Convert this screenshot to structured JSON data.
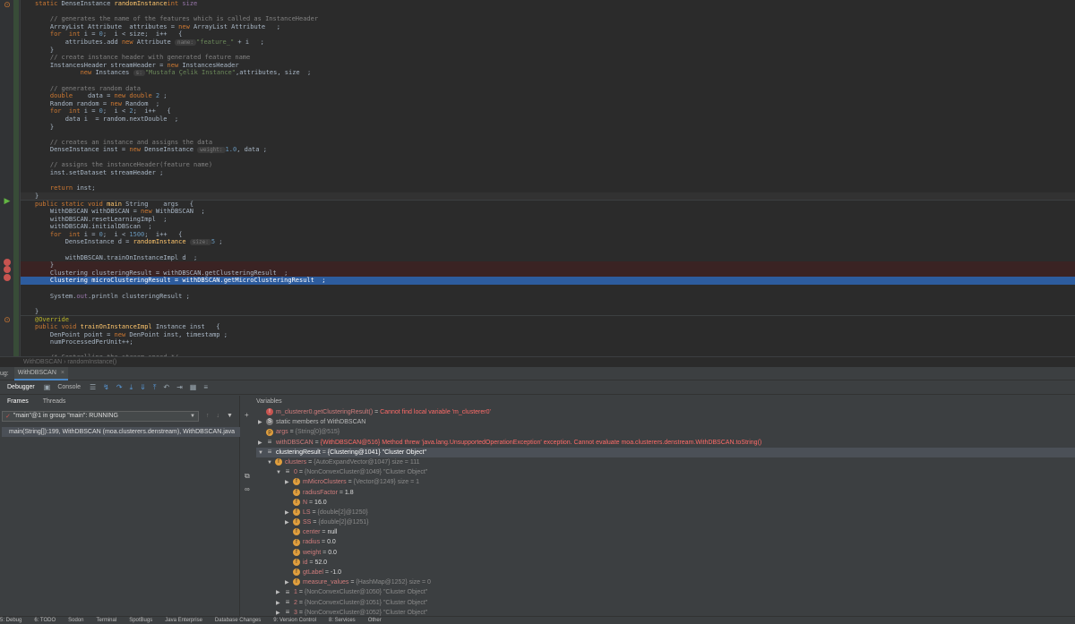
{
  "editor": {
    "lines": [
      {
        "kind": "code",
        "tokens": [
          [
            "kw",
            "static "
          ],
          [
            "",
            "DenseInstance "
          ],
          [
            "meth",
            "randomInstance"
          ],
          [
            "",
            ""
          ],
          [
            "kw",
            "int "
          ],
          [
            "fld",
            "size"
          ],
          [
            "",
            ""
          ]
        ]
      },
      {
        "kind": "blank",
        "tokens": []
      },
      {
        "kind": "code",
        "tokens": [
          [
            "cm",
            "    // generates the name of the features which is called as InstanceHeader"
          ]
        ]
      },
      {
        "kind": "code",
        "tokens": [
          [
            "",
            "    ArrayList Attribute  attributes = "
          ],
          [
            "kw",
            "new "
          ],
          [
            "",
            "ArrayList Attribute   ;"
          ]
        ]
      },
      {
        "kind": "code",
        "tokens": [
          [
            "kw",
            "    for  int "
          ],
          [
            "",
            "i = "
          ],
          [
            "num",
            "0"
          ],
          [
            "",
            ";  i < size;  i++   {"
          ]
        ]
      },
      {
        "kind": "code",
        "tokens": [
          [
            "",
            "        attributes.add "
          ],
          [
            "kw",
            "new "
          ],
          [
            "",
            "Attribute "
          ],
          [
            "hint",
            "name:"
          ],
          [
            "str",
            "\"feature_\""
          ],
          [
            "",
            " + i   ;"
          ]
        ]
      },
      {
        "kind": "code",
        "tokens": [
          [
            "",
            "    }"
          ]
        ]
      },
      {
        "kind": "code",
        "tokens": [
          [
            "cm",
            "    // create instance header with generated feature name"
          ]
        ]
      },
      {
        "kind": "code",
        "tokens": [
          [
            "",
            "    InstancesHeader streamHeader = "
          ],
          [
            "kw",
            "new "
          ],
          [
            "",
            "InstancesHeader"
          ]
        ]
      },
      {
        "kind": "code",
        "tokens": [
          [
            "",
            "            "
          ],
          [
            "kw",
            "new "
          ],
          [
            "",
            "Instances "
          ],
          [
            "hint",
            "s:"
          ],
          [
            "str",
            "\"Mustafa Çelik Instance\""
          ],
          [
            "",
            ",attributes, size  ;"
          ]
        ]
      },
      {
        "kind": "blank",
        "tokens": []
      },
      {
        "kind": "code",
        "tokens": [
          [
            "cm",
            "    // generates random data"
          ]
        ]
      },
      {
        "kind": "code",
        "tokens": [
          [
            "kw",
            "    double"
          ],
          [
            "",
            "    data = "
          ],
          [
            "kw",
            "new double "
          ],
          [
            "num",
            "2"
          ],
          [
            "",
            " ;"
          ]
        ]
      },
      {
        "kind": "code",
        "tokens": [
          [
            "",
            "    Random random = "
          ],
          [
            "kw",
            "new "
          ],
          [
            "",
            "Random  ;"
          ]
        ]
      },
      {
        "kind": "code",
        "tokens": [
          [
            "kw",
            "    for  int "
          ],
          [
            "",
            "i = "
          ],
          [
            "num",
            "0"
          ],
          [
            "",
            ";  i < "
          ],
          [
            "num",
            "2"
          ],
          [
            "",
            ";  i++   {"
          ]
        ]
      },
      {
        "kind": "code",
        "tokens": [
          [
            "",
            "        data i  = random.nextDouble  ;"
          ]
        ]
      },
      {
        "kind": "code",
        "tokens": [
          [
            "",
            "    }"
          ]
        ]
      },
      {
        "kind": "blank",
        "tokens": []
      },
      {
        "kind": "code",
        "tokens": [
          [
            "cm",
            "    // creates an instance and assigns the data"
          ]
        ]
      },
      {
        "kind": "code",
        "tokens": [
          [
            "",
            "    DenseInstance inst = "
          ],
          [
            "kw",
            "new "
          ],
          [
            "",
            "DenseInstance "
          ],
          [
            "hint",
            "weight:"
          ],
          [
            "num",
            "1.0"
          ],
          [
            "",
            ", data ;"
          ]
        ]
      },
      {
        "kind": "blank",
        "tokens": []
      },
      {
        "kind": "code",
        "tokens": [
          [
            "cm",
            "    // assigns the instanceHeader(feature name)"
          ]
        ]
      },
      {
        "kind": "code",
        "tokens": [
          [
            "",
            "    inst.setDataset streamHeader ;"
          ]
        ]
      },
      {
        "kind": "blank",
        "tokens": []
      },
      {
        "kind": "code",
        "tokens": [
          [
            "kw",
            "    return "
          ],
          [
            "",
            "inst;"
          ]
        ]
      },
      {
        "kind": "cur",
        "tokens": [
          [
            "",
            "}"
          ]
        ]
      },
      {
        "kind": "code",
        "tokens": [
          [
            "kw",
            "public static void "
          ],
          [
            "meth",
            "main "
          ],
          [
            "",
            "String    args   {"
          ]
        ]
      },
      {
        "kind": "code",
        "tokens": [
          [
            "",
            "    WithDBSCAN withDBSCAN = "
          ],
          [
            "kw",
            "new "
          ],
          [
            "",
            "WithDBSCAN  ;"
          ]
        ]
      },
      {
        "kind": "code",
        "tokens": [
          [
            "",
            "    withDBSCAN.resetLearningImpl  ;"
          ]
        ]
      },
      {
        "kind": "code",
        "tokens": [
          [
            "",
            "    withDBSCAN.initialDBScan  ;"
          ]
        ]
      },
      {
        "kind": "code",
        "tokens": [
          [
            "kw",
            "    for  int "
          ],
          [
            "",
            "i = "
          ],
          [
            "num",
            "0"
          ],
          [
            "",
            ";  i < "
          ],
          [
            "num",
            "1500"
          ],
          [
            "",
            ";  i++   {"
          ]
        ]
      },
      {
        "kind": "code",
        "tokens": [
          [
            "",
            "        DenseInstance d = "
          ],
          [
            "meth",
            "randomInstance "
          ],
          [
            "hint",
            "size:"
          ],
          [
            "num",
            "5"
          ],
          [
            "",
            " ;"
          ]
        ]
      },
      {
        "kind": "blank",
        "tokens": []
      },
      {
        "kind": "code",
        "tokens": [
          [
            "",
            "        withDBSCAN.trainOnInstanceImpl d  ;"
          ]
        ]
      },
      {
        "kind": "bp",
        "tokens": [
          [
            "",
            "    }"
          ]
        ]
      },
      {
        "kind": "bp",
        "tokens": [
          [
            "",
            "    Clustering clusteringResult = withDBSCAN.getClusteringResult  ;"
          ]
        ]
      },
      {
        "kind": "exec",
        "tokens": [
          [
            "",
            "    Clustering microClusteringResult = withDBSCAN.getMicroClusteringResult  ;"
          ]
        ]
      },
      {
        "kind": "blank",
        "tokens": []
      },
      {
        "kind": "code",
        "tokens": [
          [
            "",
            "    System."
          ],
          [
            "fld",
            "out"
          ],
          [
            "",
            ".println clusteringResult ;"
          ]
        ]
      },
      {
        "kind": "blank",
        "tokens": []
      },
      {
        "kind": "code",
        "tokens": [
          [
            "",
            "}"
          ]
        ]
      },
      {
        "kind": "code",
        "tokens": [
          [
            "ann",
            "@Override"
          ]
        ]
      },
      {
        "kind": "code",
        "tokens": [
          [
            "kw",
            "public void "
          ],
          [
            "meth",
            "trainOnInstanceImpl "
          ],
          [
            "",
            "Instance inst   {"
          ]
        ]
      },
      {
        "kind": "code",
        "tokens": [
          [
            "",
            "    DenPoint point = "
          ],
          [
            "kw",
            "new "
          ],
          [
            "",
            "DenPoint inst, timestamp ;"
          ]
        ]
      },
      {
        "kind": "code",
        "tokens": [
          [
            "",
            "    numProcessedPerUnit++;"
          ]
        ]
      },
      {
        "kind": "blank",
        "tokens": []
      },
      {
        "kind": "code",
        "tokens": [
          [
            "cm",
            "    /* Controlling the stream speed */"
          ]
        ]
      }
    ],
    "breadcrumb": "WithDBSCAN  ›  randomInstance()"
  },
  "debug": {
    "label": "ug:",
    "tab": "WithDBSCAN",
    "tab_close": "×",
    "toolbar": {
      "debugger": "Debugger",
      "console": "Console"
    },
    "frames_tab": "Frames",
    "threads_tab": "Threads",
    "thread_select": "\"main\"@1 in group \"main\": RUNNING",
    "frame_row": "main(String[]):199, WithDBSCAN (moa.clusterers.denstream), WithDBSCAN.java",
    "variables_title": "Variables",
    "vars": [
      {
        "indent": 0,
        "arrow": "",
        "icon": "e",
        "name": "m_clusterer0.getClusteringResult()",
        "eq": " = ",
        "value": "Cannot find local variable 'm_clusterer0'",
        "style": "err"
      },
      {
        "indent": 0,
        "arrow": "▶",
        "icon": "s",
        "name": "static members of WithDBSCAN",
        "eq": "",
        "value": "",
        "style": "plain"
      },
      {
        "indent": 0,
        "arrow": "",
        "icon": "p",
        "name": "args",
        "eq": " = ",
        "value": "{String[0]@515}",
        "style": "ty"
      },
      {
        "indent": 0,
        "arrow": "▶",
        "icon": "a",
        "name": "withDBSCAN",
        "eq": " = ",
        "value": "{WithDBSCAN@516} Method threw 'java.lang.UnsupportedOperationException' exception. Cannot evaluate moa.clusterers.denstream.WithDBSCAN.toString()",
        "style": "err2"
      },
      {
        "indent": 0,
        "arrow": "▼",
        "icon": "a",
        "name": "clusteringResult",
        "eq": " = ",
        "value": "{Clustering@1041} \"Cluster Object\"",
        "style": "sel"
      },
      {
        "indent": 1,
        "arrow": "▼",
        "icon": "f",
        "name": "clusters",
        "eq": " = ",
        "value": "{AutoExpandVector@1047}  size = 111",
        "style": "ty"
      },
      {
        "indent": 2,
        "arrow": "▼",
        "icon": "a",
        "name": "0",
        "eq": " = ",
        "value": "{NonConvexCluster@1049} \"Cluster Object\"",
        "style": "ty"
      },
      {
        "indent": 3,
        "arrow": "▶",
        "icon": "f",
        "name": "mMicroClusters",
        "eq": " = ",
        "value": "{Vector@1249}  size = 1",
        "style": "ty"
      },
      {
        "indent": 3,
        "arrow": "",
        "icon": "f",
        "name": "radiusFactor",
        "eq": " = ",
        "value": "1.8",
        "style": "vl"
      },
      {
        "indent": 3,
        "arrow": "",
        "icon": "f",
        "name": "N",
        "eq": " = ",
        "value": "16.0",
        "style": "vl"
      },
      {
        "indent": 3,
        "arrow": "▶",
        "icon": "f",
        "name": "LS",
        "eq": " = ",
        "value": "{double[2]@1250}",
        "style": "ty"
      },
      {
        "indent": 3,
        "arrow": "▶",
        "icon": "f",
        "name": "SS",
        "eq": " = ",
        "value": "{double[2]@1251}",
        "style": "ty"
      },
      {
        "indent": 3,
        "arrow": "",
        "icon": "f",
        "name": "center",
        "eq": " = ",
        "value": "null",
        "style": "vl"
      },
      {
        "indent": 3,
        "arrow": "",
        "icon": "f",
        "name": "radius",
        "eq": " = ",
        "value": "0.0",
        "style": "vl"
      },
      {
        "indent": 3,
        "arrow": "",
        "icon": "f",
        "name": "weight",
        "eq": " = ",
        "value": "0.0",
        "style": "vl"
      },
      {
        "indent": 3,
        "arrow": "",
        "icon": "f",
        "name": "id",
        "eq": " = ",
        "value": "52.0",
        "style": "vl"
      },
      {
        "indent": 3,
        "arrow": "",
        "icon": "f",
        "name": "gtLabel",
        "eq": " = ",
        "value": "-1.0",
        "style": "vl"
      },
      {
        "indent": 3,
        "arrow": "▶",
        "icon": "f",
        "name": "measure_values",
        "eq": " = ",
        "value": "{HashMap@1252}  size = 0",
        "style": "ty"
      },
      {
        "indent": 2,
        "arrow": "▶",
        "icon": "a",
        "name": "1",
        "eq": " = ",
        "value": "{NonConvexCluster@1050} \"Cluster Object\"",
        "style": "ty"
      },
      {
        "indent": 2,
        "arrow": "▶",
        "icon": "a",
        "name": "2",
        "eq": " = ",
        "value": "{NonConvexCluster@1051} \"Cluster Object\"",
        "style": "ty"
      },
      {
        "indent": 2,
        "arrow": "▶",
        "icon": "a",
        "name": "3",
        "eq": " = ",
        "value": "{NonConvexCluster@1052} \"Cluster Object\"",
        "style": "ty"
      }
    ]
  },
  "statusbar": {
    "items": [
      "5: Debug",
      "6: TODO",
      "Sodon",
      "Terminal",
      "SpotBugs",
      "Java Enterprise",
      "Database Changes",
      "9: Version Control",
      "8: Services",
      "Other"
    ]
  },
  "colors": {
    "editor_bg": "#2b2b2b",
    "panel_bg": "#3c3f41",
    "exec_line": "#2d5c9e",
    "breakpoint": "#c75450",
    "keyword": "#cc7832",
    "string": "#6a8759"
  },
  "icons": {
    "breakpoint": "breakpoint-icon",
    "run": "run-gutter-icon",
    "settings": "gear-icon",
    "filter": "filter-icon",
    "add_watch": "plus-icon",
    "copy": "copy-icon",
    "glasses": "glasses-icon"
  }
}
